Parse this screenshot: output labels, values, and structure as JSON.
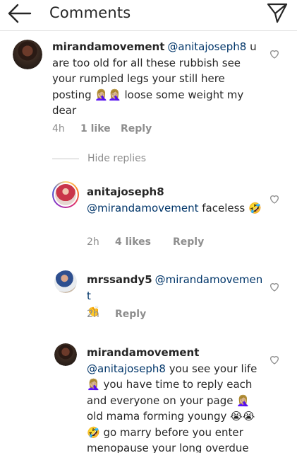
{
  "header": {
    "title": "Comments",
    "back_icon": "arrow-left-icon",
    "send_icon": "paper-plane-icon"
  },
  "comments": [
    {
      "username": "mirandamovement",
      "mention": "@anitajoseph8",
      "text": "u are too old for all these rubbish see your rumpled legs your still here posting 🤦🏼‍♀️🤦🏼‍♀️ loose some weight my dear",
      "time": "4h",
      "likes": "1 like",
      "reply": "Reply"
    }
  ],
  "hide_replies": "Hide replies",
  "replies": [
    {
      "username": "anitajoseph8",
      "mention": "@mirandamovement",
      "text": "faceless 🤣",
      "time": "2h",
      "likes": "4 likes",
      "reply": "Reply"
    },
    {
      "username": "mrssandy5",
      "mention": "@mirandamovement",
      "text": "👏",
      "time": "2h",
      "likes": "",
      "reply": "Reply"
    },
    {
      "username": "mirandamovement",
      "mention": "@anitajoseph8",
      "text": "you see your life 🤦🏼‍♀️ you have time to reply each and everyone on your page 🤦🏼‍♀️ old mama forming youngy 😭😭🤣 go marry before you enter menopause your long overdue",
      "time": "",
      "likes": "",
      "reply": ""
    }
  ],
  "colors": {
    "mention": "#003569",
    "meta": "#8e8e8e",
    "divider": "#dbdbdb"
  }
}
